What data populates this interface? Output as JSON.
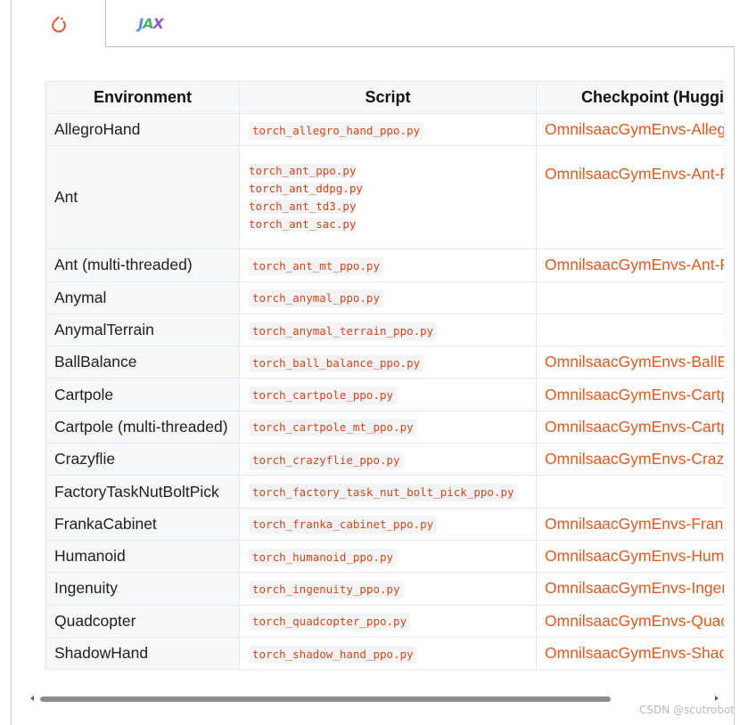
{
  "tabs": [
    {
      "icon": "pytorch-icon",
      "active": true
    },
    {
      "icon": "jax-icon",
      "label": "JAX",
      "active": false
    }
  ],
  "table": {
    "headers": [
      "Environment",
      "Script",
      "Checkpoint (Huggi"
    ],
    "rows": [
      {
        "environment": "AllegroHand",
        "scripts": [
          "torch_allegro_hand_ppo.py"
        ],
        "checkpoint": "OmnilsaacGymEnvs-Allegr"
      },
      {
        "environment": "Ant",
        "scripts": [
          "torch_ant_ppo.py",
          "torch_ant_ddpg.py",
          "torch_ant_td3.py",
          "torch_ant_sac.py"
        ],
        "checkpoint": "OmnilsaacGymEnvs-Ant-P"
      },
      {
        "environment": "Ant (multi-threaded)",
        "scripts": [
          "torch_ant_mt_ppo.py"
        ],
        "checkpoint": "OmnilsaacGymEnvs-Ant-P"
      },
      {
        "environment": "Anymal",
        "scripts": [
          "torch_anymal_ppo.py"
        ],
        "checkpoint": ""
      },
      {
        "environment": "AnymalTerrain",
        "scripts": [
          "torch_anymal_terrain_ppo.py"
        ],
        "checkpoint": ""
      },
      {
        "environment": "BallBalance",
        "scripts": [
          "torch_ball_balance_ppo.py"
        ],
        "checkpoint": "OmnilsaacGymEnvs-BallBa"
      },
      {
        "environment": "Cartpole",
        "scripts": [
          "torch_cartpole_ppo.py"
        ],
        "checkpoint": "OmnilsaacGymEnvs-Cartp"
      },
      {
        "environment": "Cartpole (multi-threaded)",
        "scripts": [
          "torch_cartpole_mt_ppo.py"
        ],
        "checkpoint": "OmnilsaacGymEnvs-Cartp"
      },
      {
        "environment": "Crazyflie",
        "scripts": [
          "torch_crazyflie_ppo.py"
        ],
        "checkpoint": "OmnilsaacGymEnvs-Crazy"
      },
      {
        "environment": "FactoryTaskNutBoltPick",
        "scripts": [
          "torch_factory_task_nut_bolt_pick_ppo.py"
        ],
        "checkpoint": ""
      },
      {
        "environment": "FrankaCabinet",
        "scripts": [
          "torch_franka_cabinet_ppo.py"
        ],
        "checkpoint": "OmnilsaacGymEnvs-Frank"
      },
      {
        "environment": "Humanoid",
        "scripts": [
          "torch_humanoid_ppo.py"
        ],
        "checkpoint": "OmnilsaacGymEnvs-Huma"
      },
      {
        "environment": "Ingenuity",
        "scripts": [
          "torch_ingenuity_ppo.py"
        ],
        "checkpoint": "OmnilsaacGymEnvs-Ingen"
      },
      {
        "environment": "Quadcopter",
        "scripts": [
          "torch_quadcopter_ppo.py"
        ],
        "checkpoint": "OmnilsaacGymEnvs-Quad"
      },
      {
        "environment": "ShadowHand",
        "scripts": [
          "torch_shadow_hand_ppo.py"
        ],
        "checkpoint": "OmnilsaacGymEnvs-Shado"
      }
    ]
  },
  "scrollbar": {
    "horizontal_position": 0.0
  },
  "watermark": "CSDN @scutrobot",
  "colors": {
    "accent": "#e0591e",
    "code": "#d4461a",
    "pytorch": "#ee4c2c"
  }
}
